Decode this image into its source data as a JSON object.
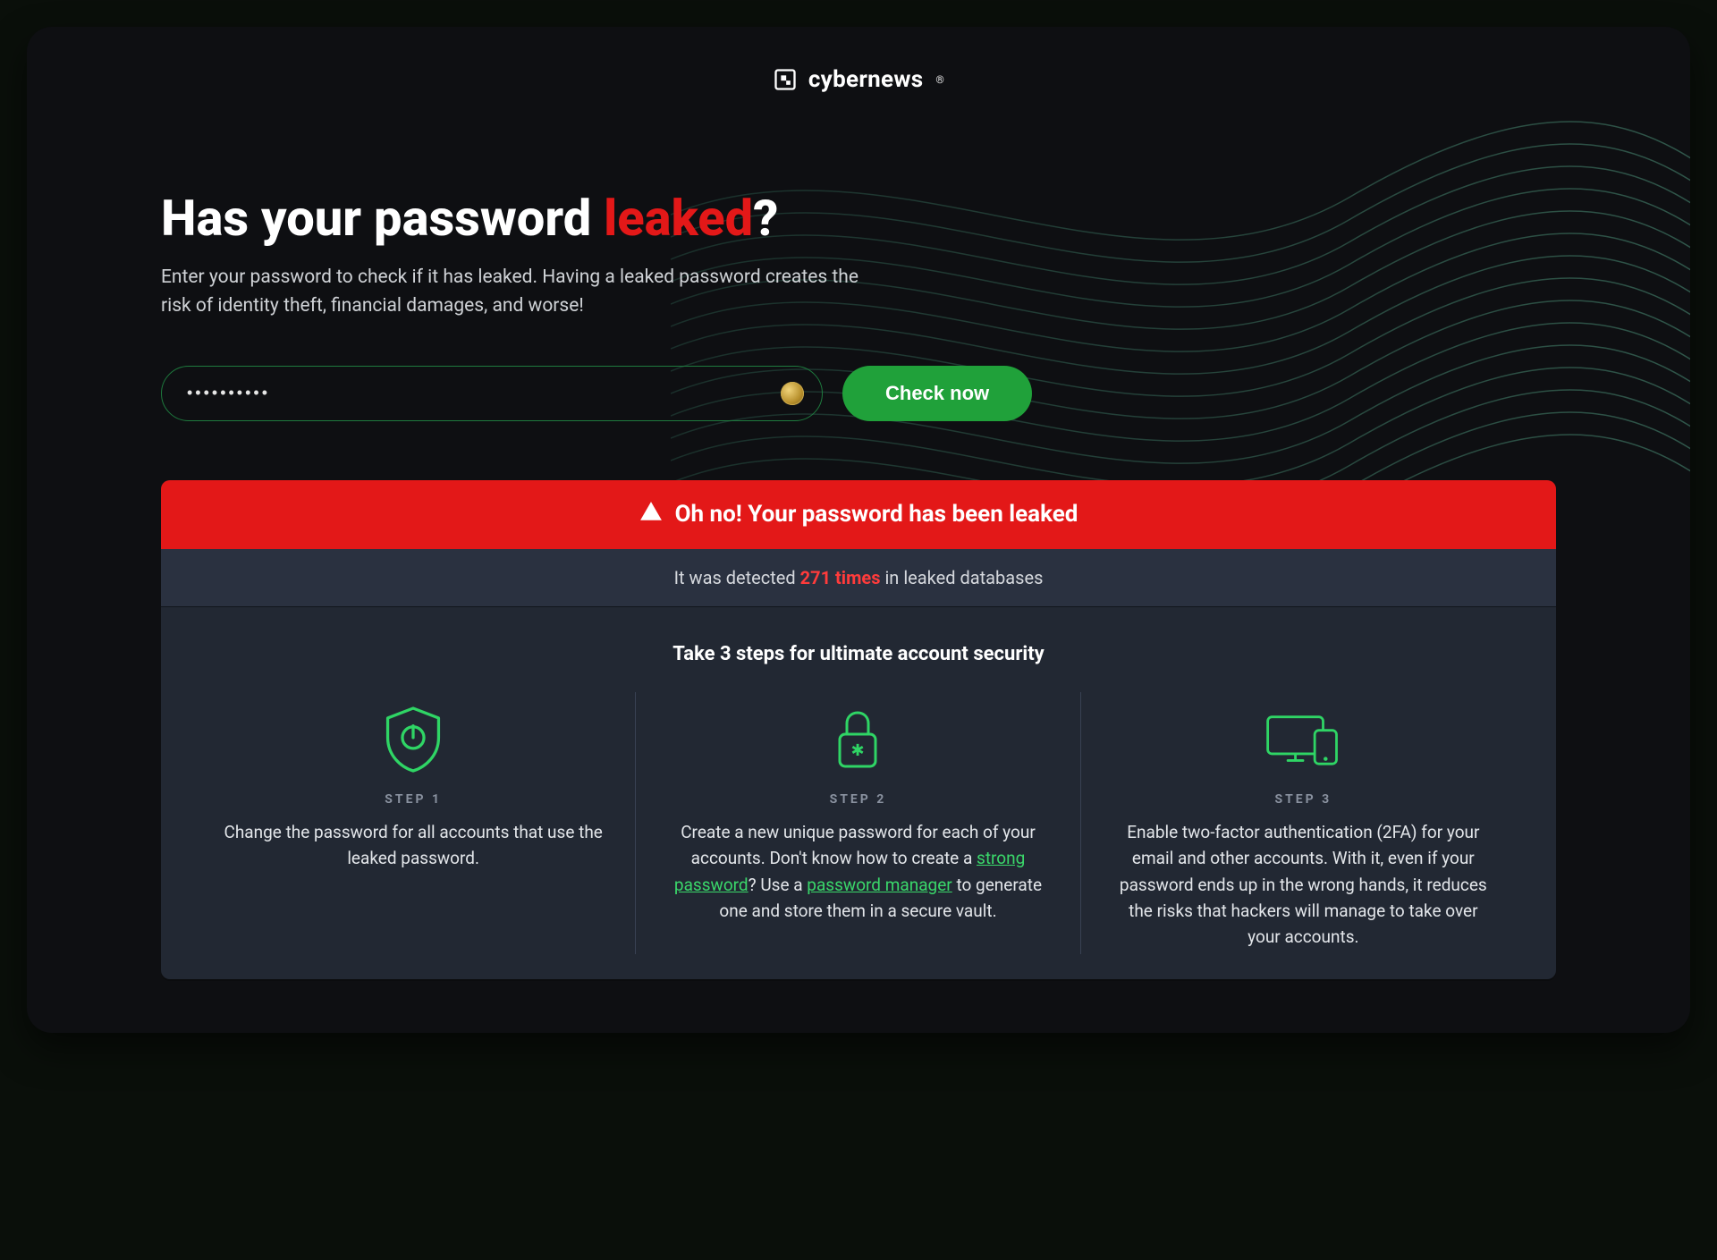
{
  "brand": {
    "name": "cybernews",
    "reg": "®"
  },
  "hero": {
    "title_pre": "Has your password ",
    "title_accent": "leaked",
    "title_post": "?",
    "subtitle": "Enter your password to check if it has leaked. Having a leaked password creates the risk of identity theft, financial damages, and worse!"
  },
  "search": {
    "input_value": "••••••••••",
    "placeholder": "",
    "button_label": "Check now"
  },
  "result": {
    "alert_text": "Oh no! Your password has been leaked",
    "detected_pre": "It was detected ",
    "detected_count": "271 times",
    "detected_post": " in leaked databases"
  },
  "steps_section": {
    "heading": "Take 3 steps for ultimate account security",
    "steps": [
      {
        "label": "STEP 1",
        "text_pre": "Change the password for all accounts that use the leaked password.",
        "link1": "",
        "mid1": "",
        "link2": "",
        "text_post": ""
      },
      {
        "label": "STEP 2",
        "text_pre": "Create a new unique password for each of your accounts. Don't know how to create a ",
        "link1": "strong password",
        "mid1": "? Use a ",
        "link2": "password manager",
        "text_post": " to generate one and store them in a secure vault."
      },
      {
        "label": "STEP 3",
        "text_pre": "Enable two-factor authentication (2FA) for your email and other accounts. With it, even if your password ends up in the wrong hands, it reduces the risks that hackers will manage to take over your accounts.",
        "link1": "",
        "mid1": "",
        "link2": "",
        "text_post": ""
      }
    ]
  },
  "colors": {
    "accent_red": "#e31818",
    "accent_green": "#20a13a",
    "panel": "#222833"
  }
}
